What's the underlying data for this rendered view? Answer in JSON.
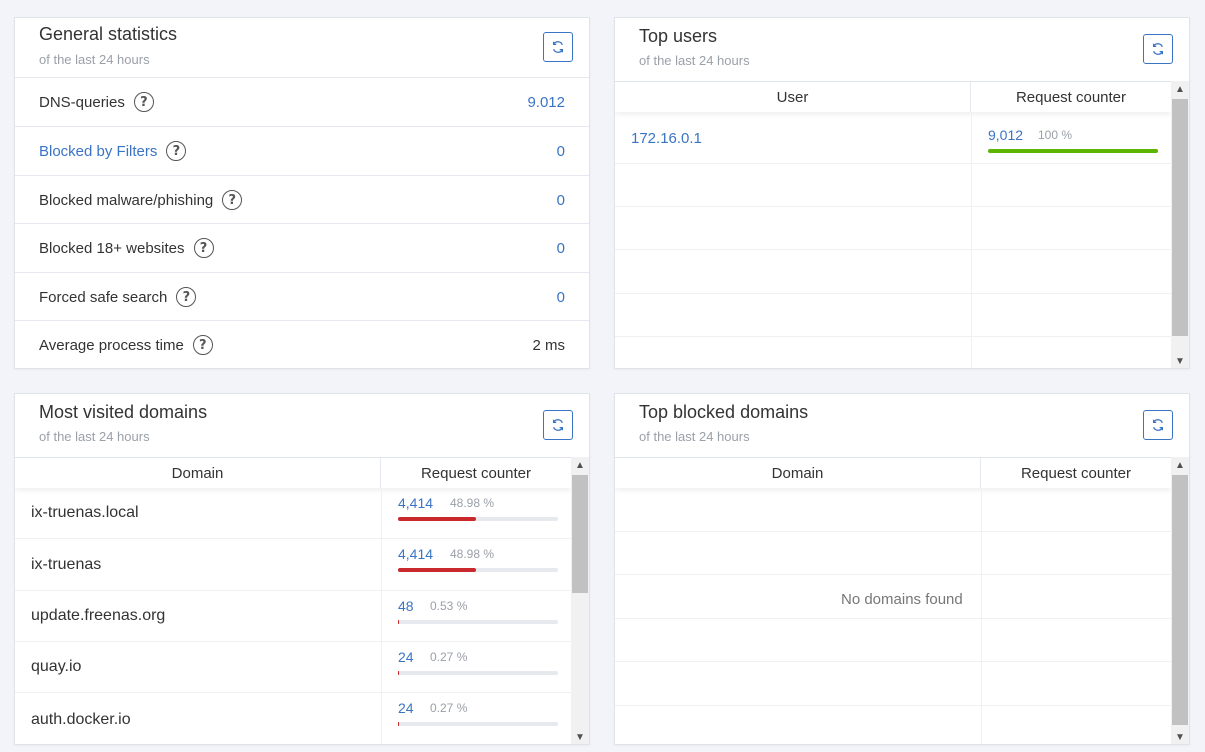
{
  "general": {
    "title": "General statistics",
    "subtitle": "of the last 24 hours",
    "rows": [
      {
        "label": "DNS-queries",
        "value": "9.012"
      },
      {
        "label": "Blocked by Filters",
        "value": "0"
      },
      {
        "label": "Blocked malware/phishing",
        "value": "0"
      },
      {
        "label": "Blocked 18+ websites",
        "value": "0"
      },
      {
        "label": "Forced safe search",
        "value": "0"
      },
      {
        "label": "Average process time",
        "value": "2 ms"
      }
    ]
  },
  "top_users": {
    "title": "Top users",
    "subtitle": "of the last 24 hours",
    "col_user": "User",
    "col_counter": "Request counter",
    "rows": [
      {
        "user": "172.16.0.1",
        "count": "9,012",
        "percent": "100 %",
        "fraction": 1.0,
        "bar_color": "#5cb500"
      }
    ]
  },
  "most_visited": {
    "title": "Most visited domains",
    "subtitle": "of the last 24 hours",
    "col_domain": "Domain",
    "col_counter": "Request counter",
    "rows": [
      {
        "domain": "ix-truenas.local",
        "count": "4,414",
        "percent": "48.98 %",
        "fraction": 0.4898,
        "bar_color": "#c9282d"
      },
      {
        "domain": "ix-truenas",
        "count": "4,414",
        "percent": "48.98 %",
        "fraction": 0.4898,
        "bar_color": "#c9282d"
      },
      {
        "domain": "update.freenas.org",
        "count": "48",
        "percent": "0.53 %",
        "fraction": 0.0053,
        "bar_color": "#c9282d"
      },
      {
        "domain": "quay.io",
        "count": "24",
        "percent": "0.27 %",
        "fraction": 0.0027,
        "bar_color": "#c9282d"
      },
      {
        "domain": "auth.docker.io",
        "count": "24",
        "percent": "0.27 %",
        "fraction": 0.0027,
        "bar_color": "#c9282d"
      }
    ]
  },
  "top_blocked": {
    "title": "Top blocked domains",
    "subtitle": "of the last 24 hours",
    "col_domain": "Domain",
    "col_counter": "Request counter",
    "empty_text": "No domains found"
  },
  "icons": {
    "refresh": "refresh-icon",
    "help": "help-icon"
  },
  "colors": {
    "accent": "#3a74c4",
    "success": "#5cb500",
    "danger": "#c9282d"
  }
}
